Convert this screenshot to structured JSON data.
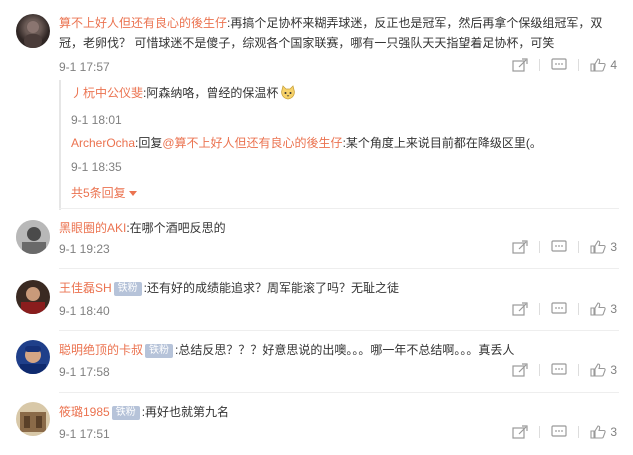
{
  "comments": [
    {
      "user": "算不上好人但还有良心的後生仔",
      "text": ":再搞个足协杯来糊弄球迷，反正也是冠军，然后再拿个保级组冠军，双冠，老卵伐？ 可惜球迷不是傻子，综观各个国家联赛，哪有一只强队天天指望着足协杯，可笑",
      "time": "9-1 17:57",
      "likes": "4",
      "replies": [
        {
          "user": "丿杬中公仪斐",
          "text": ":阿森纳咯，曾经的保温杯",
          "time": "9-1 18:01"
        },
        {
          "user": "ArcherOcha",
          "prefix": ":回复",
          "mention": "@算不上好人但还有良心的後生仔",
          "text": ":某个角度上来说目前都在降级区里(。",
          "time": "9-1 18:35"
        }
      ],
      "more": "共5条回复"
    },
    {
      "user": "黑眼圈的AKI",
      "badge": "",
      "text": ":在哪个酒吧反思的",
      "time": "9-1 19:23",
      "likes": "3"
    },
    {
      "user": "王佳磊SH",
      "badge": "铁粉",
      "text": ":还有好的成绩能追求？周军能滚了吗？无耻之徒",
      "time": "9-1 18:40",
      "likes": "3"
    },
    {
      "user": "聪明绝顶的卡叔",
      "badge": "铁粉",
      "text": ":总结反思？？？好意思说的出噢。。。哪一年不总结啊。。。真丢人",
      "time": "9-1 17:58",
      "likes": "3"
    },
    {
      "user": "筱璐1985",
      "badge": "铁粉",
      "text": ":再好也就第九名",
      "time": "9-1 17:51",
      "likes": "3"
    }
  ],
  "icons": {
    "share": "share-icon",
    "comment": "comment-icon",
    "like": "thumbs-up-icon",
    "expand": "caret-down-icon"
  },
  "colors": {
    "username": "#eb7350",
    "badge": "#b6c3d9",
    "muted": "#808080"
  }
}
